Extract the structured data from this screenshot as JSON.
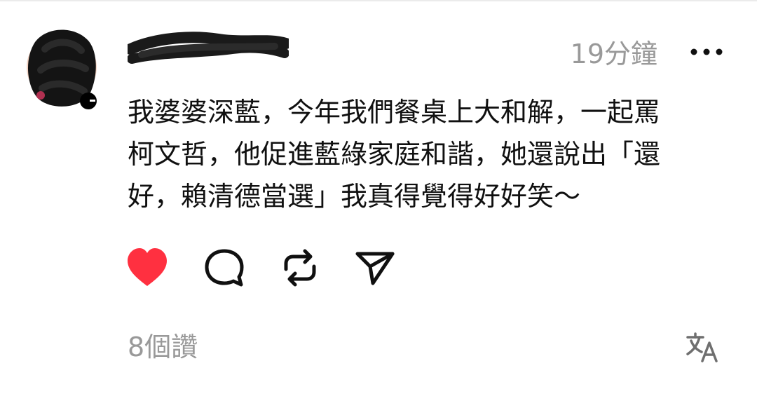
{
  "post": {
    "timestamp": "19分鐘",
    "body": "我婆婆深藍，今年我們餐桌上大和解，一起罵\n柯文哲，他促進藍綠家庭和諧，她還說出「還\n好，賴清德當選」我真得覺得好好笑～",
    "likes_label": "8個讚"
  },
  "icons": {
    "more": "more-horizontal-icon",
    "like": "heart-filled-icon",
    "comment": "comment-bubble-icon",
    "repost": "repost-icon",
    "share": "send-icon",
    "translate": "translate-icon"
  },
  "colors": {
    "like_active": "#ff3040",
    "text": "#101010",
    "muted": "#999999"
  }
}
